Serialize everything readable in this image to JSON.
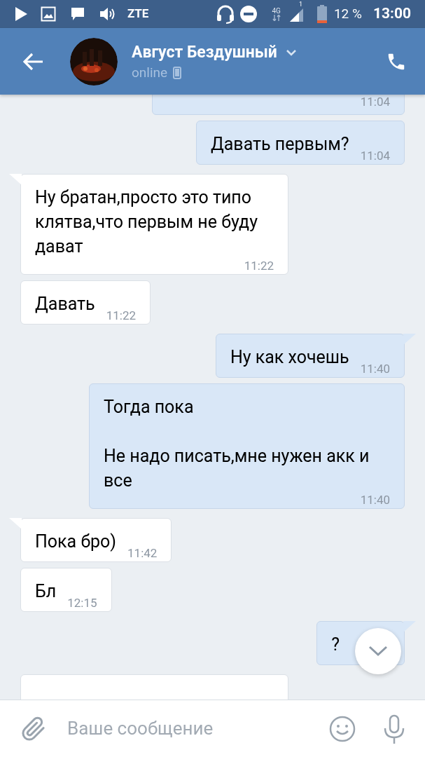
{
  "status_bar": {
    "carrier": "ZTE",
    "network": "4G",
    "sim": "1",
    "battery": "12 %",
    "time": "13:00"
  },
  "header": {
    "name": "Август Бездушный",
    "status": "online"
  },
  "messages": [
    {
      "kind": "outgoing",
      "time": "11:04"
    },
    {
      "kind": "outgoing",
      "text": "Давать первым?",
      "time": "11:04"
    },
    {
      "kind": "incoming",
      "text": "Ну братан,просто это типо клятва,что первым не буду дават",
      "time": "11:22"
    },
    {
      "kind": "incoming",
      "text": "Давать",
      "time": "11:22"
    },
    {
      "kind": "outgoing",
      "text": "Ну как хочешь",
      "time": "11:40"
    },
    {
      "kind": "outgoing",
      "text": "Тогда пока\n\nНе надо писать,мне нужен акк и все",
      "time": "11:40"
    },
    {
      "kind": "incoming",
      "text": "Пока бро)",
      "time": "11:42"
    },
    {
      "kind": "incoming",
      "text": "Бл",
      "time": "12:15"
    },
    {
      "kind": "outgoing",
      "text": "?"
    },
    {
      "kind": "incoming"
    }
  ],
  "composer": {
    "placeholder": "Ваше сообщение"
  }
}
